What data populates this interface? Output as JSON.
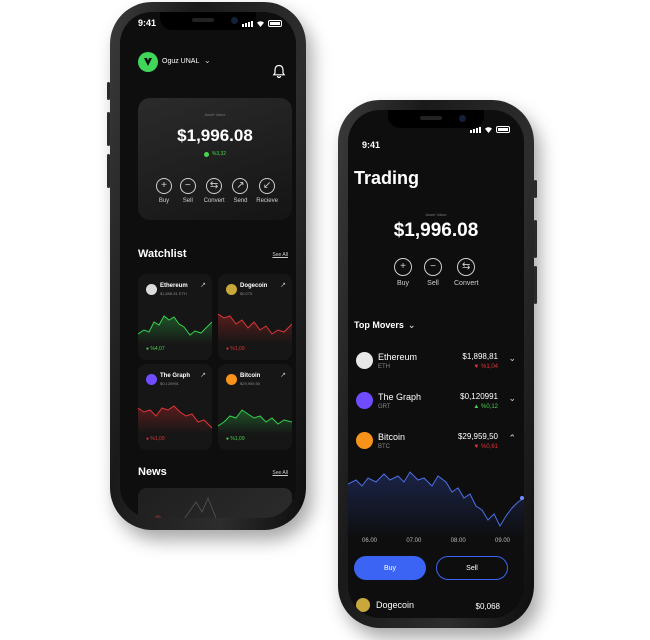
{
  "left_phone": {
    "status_time": "9:41",
    "user_name": "Oguz UNAL",
    "balance_label": "Asset Value",
    "balance": "$1,996.08",
    "balance_change": "%3,32",
    "actions": [
      "Buy",
      "Sell",
      "Convert",
      "Send",
      "Recieve"
    ],
    "watchlist_title": "Watchlist",
    "see_all": "See All",
    "watchlist": [
      {
        "name": "Ethereum",
        "sub": "$1,898.81 ETH",
        "change": "%4,07",
        "trend": "up",
        "color": "#dcdcdc"
      },
      {
        "name": "Dogecoin",
        "sub": "$0,075",
        "change": "%1,09",
        "trend": "down",
        "color": "#c9a83b"
      },
      {
        "name": "The Graph",
        "sub": "$0,120991",
        "change": "%1,09",
        "trend": "down",
        "color": "#6f4cff"
      },
      {
        "name": "Bitcoin",
        "sub": "$29,959,50",
        "change": "%1,09",
        "trend": "up",
        "color": "#f7931a"
      }
    ],
    "news_title": "News",
    "news_see_all": "See All"
  },
  "right_phone": {
    "status_time": "9:41",
    "title": "Trading",
    "balance_label": "Asset Value",
    "balance": "$1,996.08",
    "actions": [
      "Buy",
      "Sell",
      "Convert"
    ],
    "top_movers_title": "Top Movers",
    "movers": [
      {
        "name": "Ethereum",
        "ticker": "ETH",
        "price": "$1,898,81",
        "change": "%1,04",
        "trend": "down",
        "color": "#e8e8e8",
        "expanded": false
      },
      {
        "name": "The Graph",
        "ticker": "GRT",
        "price": "$0,120991",
        "change": "%0,12",
        "trend": "up",
        "color": "#6f4cff",
        "expanded": false
      },
      {
        "name": "Bitcoin",
        "ticker": "BTC",
        "price": "$29,959,50",
        "change": "%0,61",
        "trend": "down",
        "color": "#f7931a",
        "expanded": true
      }
    ],
    "chart_times": [
      "06.00",
      "07.00",
      "08.00",
      "09.00"
    ],
    "buy_label": "Buy",
    "sell_label": "Sell",
    "peek_name": "Dogecoin",
    "peek_price": "$0,068"
  }
}
